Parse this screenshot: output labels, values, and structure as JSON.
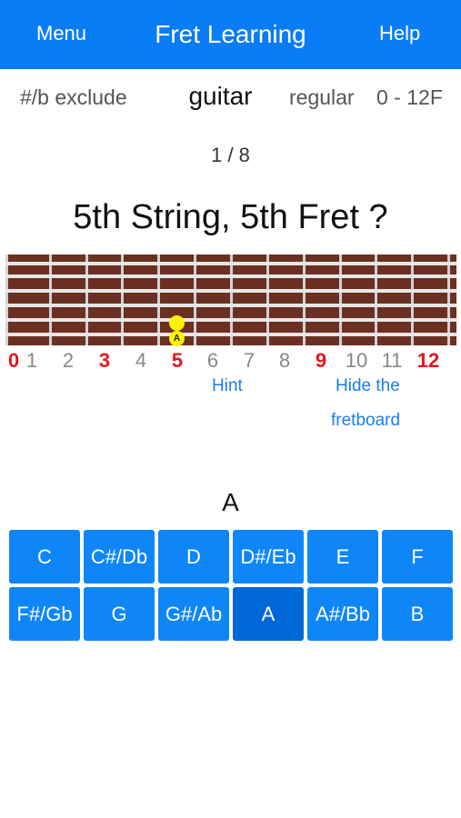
{
  "header": {
    "menu_label": "Menu",
    "title": "Fret Learning",
    "help_label": "Help"
  },
  "options": {
    "accidental": "#/b exclude",
    "instrument": "guitar",
    "tuning": "regular",
    "range": "0 - 12F"
  },
  "progress": {
    "counter": "1 / 8"
  },
  "question": "5th String, 5th Fret ?",
  "fretboard": {
    "marker_label": "A",
    "fret_numbers": [
      "0",
      "1",
      "2",
      "3",
      "4",
      "5",
      "6",
      "7",
      "8",
      "9",
      "10",
      "11",
      "12"
    ],
    "highlighted_frets": [
      "0",
      "3",
      "5",
      "9",
      "12"
    ]
  },
  "links": {
    "hint": "Hint",
    "hide_line1": "Hide the",
    "hide_line2": "fretboard"
  },
  "answer": "A",
  "notes": [
    "C",
    "C#/Db",
    "D",
    "D#/Eb",
    "E",
    "F",
    "F#/Gb",
    "G",
    "G#/Ab",
    "A",
    "A#/Bb",
    "B"
  ],
  "colors": {
    "accent": "#0a7cf5",
    "button": "#0f86f7",
    "button_selected": "#0068d6",
    "fretboard": "#6b3022",
    "highlight": "#e8141d",
    "marker": "#fff200"
  }
}
